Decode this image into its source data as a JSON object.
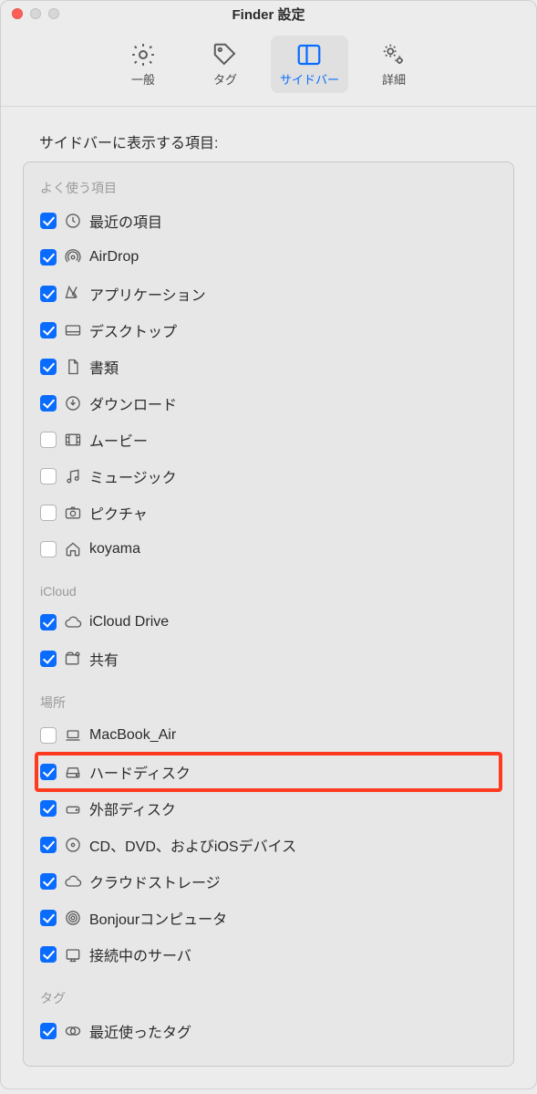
{
  "window": {
    "title": "Finder 設定"
  },
  "toolbar": {
    "general": "一般",
    "tags": "タグ",
    "sidebar": "サイドバー",
    "advanced": "詳細",
    "active": "sidebar"
  },
  "content": {
    "section_label": "サイドバーに表示する項目:",
    "groups": [
      {
        "key": "favorites",
        "title": "よく使う項目",
        "items": [
          {
            "key": "recent",
            "label": "最近の項目",
            "checked": true,
            "icon": "clock-icon"
          },
          {
            "key": "airdrop",
            "label": "AirDrop",
            "checked": true,
            "icon": "airdrop-icon"
          },
          {
            "key": "apps",
            "label": "アプリケーション",
            "checked": true,
            "icon": "apps-icon"
          },
          {
            "key": "desktop",
            "label": "デスクトップ",
            "checked": true,
            "icon": "desktop-icon"
          },
          {
            "key": "documents",
            "label": "書類",
            "checked": true,
            "icon": "document-icon"
          },
          {
            "key": "downloads",
            "label": "ダウンロード",
            "checked": true,
            "icon": "download-icon"
          },
          {
            "key": "movies",
            "label": "ムービー",
            "checked": false,
            "icon": "movie-icon"
          },
          {
            "key": "music",
            "label": "ミュージック",
            "checked": false,
            "icon": "music-icon"
          },
          {
            "key": "pictures",
            "label": "ピクチャ",
            "checked": false,
            "icon": "camera-icon"
          },
          {
            "key": "home",
            "label": "koyama",
            "checked": false,
            "icon": "house-icon"
          }
        ]
      },
      {
        "key": "icloud",
        "title": "iCloud",
        "items": [
          {
            "key": "iclouddrive",
            "label": "iCloud Drive",
            "checked": true,
            "icon": "cloud-icon"
          },
          {
            "key": "shared",
            "label": "共有",
            "checked": true,
            "icon": "shared-folder-icon"
          }
        ]
      },
      {
        "key": "locations",
        "title": "場所",
        "items": [
          {
            "key": "computer",
            "label": "MacBook_Air",
            "checked": false,
            "icon": "laptop-icon"
          },
          {
            "key": "harddisk",
            "label": "ハードディスク",
            "checked": true,
            "icon": "harddisk-icon",
            "highlight": true
          },
          {
            "key": "external",
            "label": "外部ディスク",
            "checked": true,
            "icon": "external-disk-icon"
          },
          {
            "key": "optical",
            "label": "CD、DVD、およびiOSデバイス",
            "checked": true,
            "icon": "disc-icon"
          },
          {
            "key": "cloud",
            "label": "クラウドストレージ",
            "checked": true,
            "icon": "cloud-icon"
          },
          {
            "key": "bonjour",
            "label": "Bonjourコンピュータ",
            "checked": true,
            "icon": "bonjour-icon"
          },
          {
            "key": "servers",
            "label": "接続中のサーバ",
            "checked": true,
            "icon": "server-icon"
          }
        ]
      },
      {
        "key": "tags",
        "title": "タグ",
        "items": [
          {
            "key": "recenttags",
            "label": "最近使ったタグ",
            "checked": true,
            "icon": "tags-icon"
          }
        ]
      }
    ]
  }
}
